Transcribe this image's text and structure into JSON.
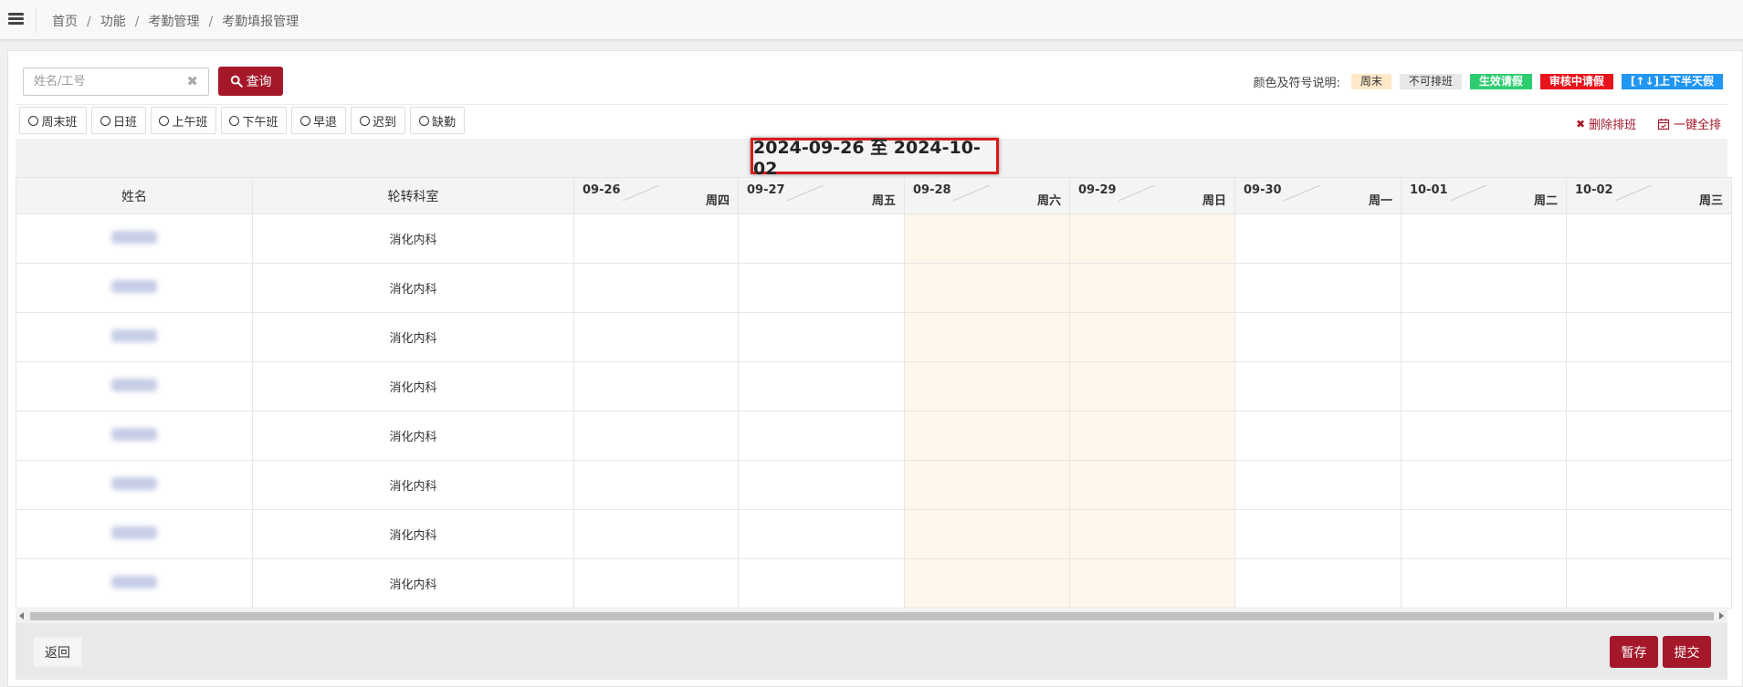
{
  "breadcrumb": [
    "首页",
    "功能",
    "考勤管理",
    "考勤填报管理"
  ],
  "search": {
    "placeholder": "姓名/工号",
    "value": "",
    "button_label": "查询"
  },
  "legend": {
    "title": "颜色及符号说明:",
    "items": [
      {
        "label": "周末",
        "color": "#fde8c8"
      },
      {
        "label": "不可排班",
        "color": "#e8e8e8"
      },
      {
        "label": "生效请假",
        "color": "#2ecc71"
      },
      {
        "label": "审核中请假",
        "color": "#e8141c"
      },
      {
        "label": "[↑↓]上下半天假",
        "color": "#2196f3"
      }
    ]
  },
  "shift_options": [
    "周末班",
    "日班",
    "上午班",
    "下午班",
    "早退",
    "迟到",
    "缺勤"
  ],
  "actions": {
    "delete_label": "删除排班",
    "auto_label": "一键全排"
  },
  "date_range": "2024-09-26 至 2024-10-02",
  "table": {
    "headers": {
      "name": "姓名",
      "dept": "轮转科室"
    },
    "days": [
      {
        "date": "09-26",
        "weekday": "周四",
        "weekend": false
      },
      {
        "date": "09-27",
        "weekday": "周五",
        "weekend": false
      },
      {
        "date": "09-28",
        "weekday": "周六",
        "weekend": true
      },
      {
        "date": "09-29",
        "weekday": "周日",
        "weekend": true
      },
      {
        "date": "09-30",
        "weekday": "周一",
        "weekend": false
      },
      {
        "date": "10-01",
        "weekday": "周二",
        "weekend": false
      },
      {
        "date": "10-02",
        "weekday": "周三",
        "weekend": false
      }
    ],
    "rows": [
      {
        "dept": "消化内科"
      },
      {
        "dept": "消化内科"
      },
      {
        "dept": "消化内科"
      },
      {
        "dept": "消化内科"
      },
      {
        "dept": "消化内科"
      },
      {
        "dept": "消化内科"
      },
      {
        "dept": "消化内科"
      },
      {
        "dept": "消化内科"
      }
    ]
  },
  "footer": {
    "back_label": "返回",
    "save_label": "暂存",
    "submit_label": "提交"
  },
  "colors": {
    "primary": "#a5182a",
    "weekend_cell": "#fdf6ea",
    "highlight_border": "#d91a1a"
  }
}
